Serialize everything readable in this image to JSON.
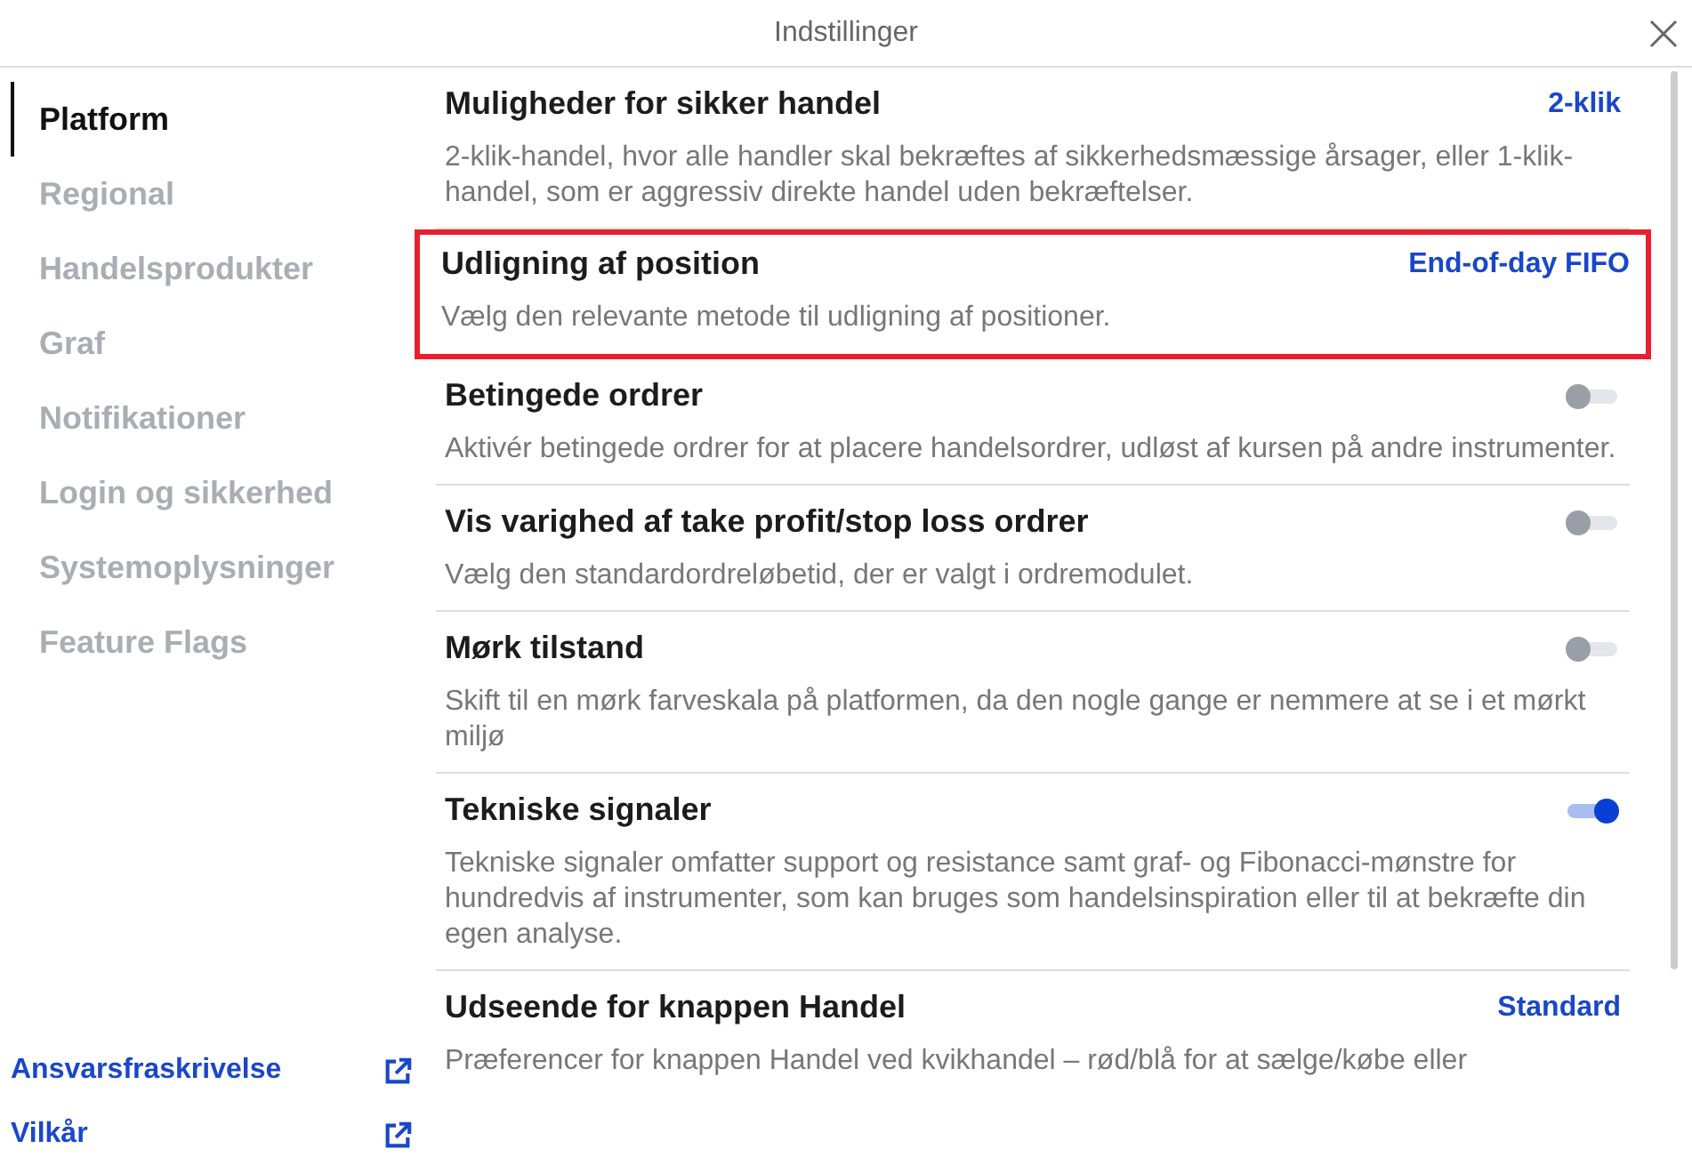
{
  "window": {
    "title": "Indstillinger"
  },
  "sidebar": {
    "items": [
      {
        "label": "Platform",
        "selected": true
      },
      {
        "label": "Regional",
        "selected": false
      },
      {
        "label": "Handelsprodukter",
        "selected": false
      },
      {
        "label": "Graf",
        "selected": false
      },
      {
        "label": "Notifikationer",
        "selected": false
      },
      {
        "label": "Login og sikkerhed",
        "selected": false
      },
      {
        "label": "Systemoplysninger",
        "selected": false
      },
      {
        "label": "Feature Flags",
        "selected": false
      }
    ],
    "links": [
      {
        "label": "Ansvarsfraskrivelse"
      },
      {
        "label": "Vilkår"
      }
    ]
  },
  "settings": [
    {
      "kind": "choice",
      "title": "Muligheder for sikker handel",
      "value": "2-klik",
      "description": "2-klik-handel, hvor alle handler skal bekræftes af sikkerhedsmæssige årsager, eller 1-klik-handel, som er aggressiv direkte handel uden bekræftelser.",
      "highlighted": false
    },
    {
      "kind": "choice",
      "title": "Udligning af position",
      "value": "End-of-day FIFO",
      "description": "Vælg den relevante metode til udligning af positioner.",
      "highlighted": true
    },
    {
      "kind": "toggle",
      "title": "Betingede ordrer",
      "on": false,
      "description": "Aktivér betingede ordrer for at placere handelsordrer, udløst af kursen på andre instrumenter.",
      "highlighted": false
    },
    {
      "kind": "toggle",
      "title": "Vis varighed af take profit/stop loss ordrer",
      "on": false,
      "description": "Vælg den standardordreløbetid, der er valgt i ordremodulet.",
      "highlighted": false
    },
    {
      "kind": "toggle",
      "title": "Mørk tilstand",
      "on": false,
      "description": "Skift til en mørk farveskala på platformen, da den nogle gange er nemmere at se i et mørkt miljø",
      "highlighted": false
    },
    {
      "kind": "toggle",
      "title": "Tekniske signaler",
      "on": true,
      "description": "Tekniske signaler omfatter support og resistance samt graf- og Fibonacci-mønstre for hundredvis af instrumenter, som kan bruges som handelsinspiration eller til at bekræfte din egen analyse.",
      "highlighted": false
    },
    {
      "kind": "choice",
      "title": "Udseende for knappen Handel",
      "value": "Standard",
      "description": "Præferencer for knappen Handel ved kvikhandel – rød/blå for at sælge/købe eller",
      "highlighted": false
    }
  ]
}
